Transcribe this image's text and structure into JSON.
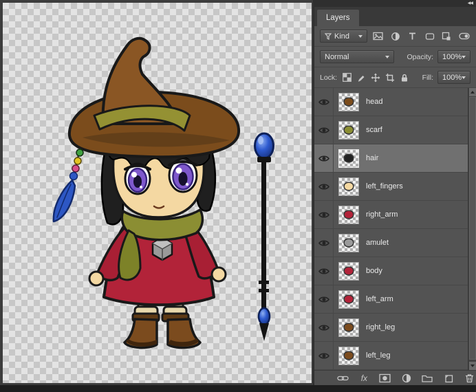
{
  "window": {
    "icons": {
      "collapse": "◀◀"
    }
  },
  "canvas": {
    "artwork": "chibi witch character with beaded hat and magic staff",
    "palette": {
      "hat": "#7b4c1c",
      "hat_crown": "#8a5624",
      "hat_band": "#949133",
      "hair": "#1f1f1f",
      "skin": "#f4d8a2",
      "iris": "#7e58cc",
      "dress": "#b22339",
      "sleeve": "#a81f34",
      "scarf": "#8b8e33",
      "scarf_tail": "#7d8228",
      "sock": "#efe2bb",
      "boot": "#7b4b1e",
      "feather": "#2d57c4",
      "outline": "#191919"
    }
  },
  "panel": {
    "tab": "Layers",
    "filter": {
      "kind": "Kind"
    },
    "blend": {
      "mode": "Normal",
      "opacity_label": "Opacity:",
      "opacity_value": "100%"
    },
    "lock": {
      "label": "Lock:",
      "fill_label": "Fill:",
      "fill_value": "100%"
    },
    "layers": {
      "items": [
        {
          "name": "head",
          "thumb": "#7b4c1c",
          "selected": false
        },
        {
          "name": "scarf",
          "thumb": "#8b8e33",
          "selected": false
        },
        {
          "name": "hair",
          "thumb": "#222222",
          "selected": true
        },
        {
          "name": "left_fingers",
          "thumb": "#f4d8a2",
          "selected": false
        },
        {
          "name": "right_arm",
          "thumb": "#b22339",
          "selected": false
        },
        {
          "name": "amulet",
          "thumb": "#9a9a9a",
          "selected": false
        },
        {
          "name": "body",
          "thumb": "#b22339",
          "selected": false
        },
        {
          "name": "left_arm",
          "thumb": "#b22339",
          "selected": false
        },
        {
          "name": "right_leg",
          "thumb": "#7b4b1e",
          "selected": false
        },
        {
          "name": "left_leg",
          "thumb": "#7b4b1e",
          "selected": false
        }
      ]
    },
    "toolbar": {
      "fx_label": "fx"
    }
  }
}
